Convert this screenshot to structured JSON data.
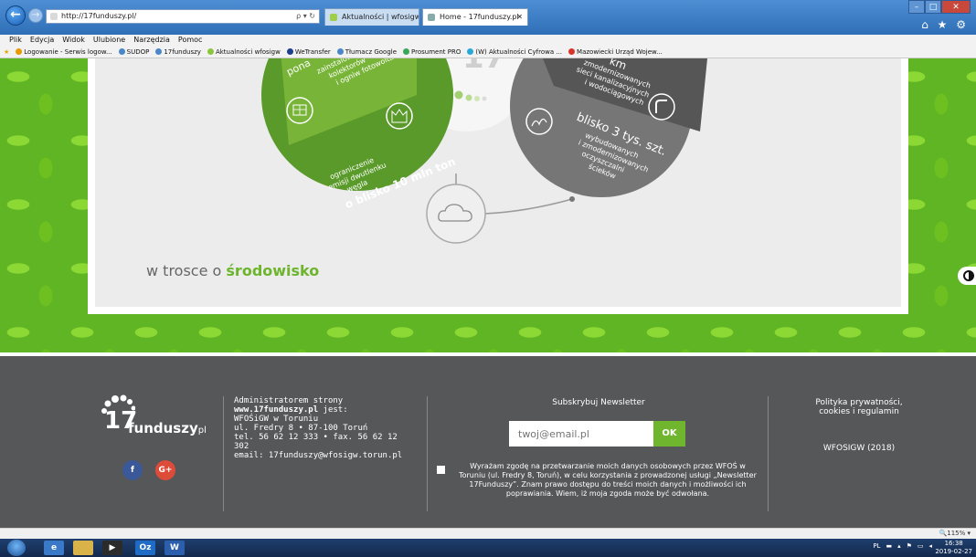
{
  "browser": {
    "address": "http://17funduszy.pl/",
    "address_actions": "ρ ▾ ↻",
    "tabs": [
      {
        "label": "Aktualności | wfosigw.pl"
      },
      {
        "label": "Home - 17funduszy.pl"
      }
    ],
    "tab_close": "✕",
    "window_controls": {
      "minimize": "–",
      "maximize": "□",
      "close": "✕"
    },
    "right_icons": "⌂ ★ ⚙"
  },
  "menu": [
    "Plik",
    "Edycja",
    "Widok",
    "Ulubione",
    "Narzędzia",
    "Pomoc"
  ],
  "favorites": [
    {
      "label": "Logowanie - Serwis logow...",
      "color": "#e69b00"
    },
    {
      "label": "SUDOP",
      "color": "#4a86c8"
    },
    {
      "label": "17funduszy",
      "color": "#4a86c8"
    },
    {
      "label": "Aktualności wfosigw",
      "color": "#8cc63f"
    },
    {
      "label": "WeTransfer",
      "color": "#1d3f8c"
    },
    {
      "label": "Tłumacz Google",
      "color": "#4a86c8"
    },
    {
      "label": "Prosument PRO",
      "color": "#3aa65a"
    },
    {
      "label": "(W) Aktualności Cyfrowa ...",
      "color": "#2aa9d9"
    },
    {
      "label": "Mazowiecki Urząd Wojew...",
      "color": "#d9342b"
    }
  ],
  "graphic": {
    "green_circle": {
      "line1": "ograniczenie",
      "line2": "emisji dwutlenku",
      "line3": "węgla",
      "highlight": "o blisko 10 mln ton"
    },
    "green_top": {
      "lines": [
        "zainstalowanych",
        "kolektorów",
        "i ogniw fotowoltaicz"
      ],
      "partial": "pona"
    },
    "grey_circle": {
      "highlight": "blisko 3 tys. szt.",
      "lines": [
        "wybudowanych",
        "i zmodernizowanych",
        "oczyszczalni",
        "ścieków"
      ]
    },
    "grey_top": {
      "partial": "km",
      "lines": [
        "zmodernizowanych",
        "sieci kanalizacyjnych",
        "i wodociągowych"
      ]
    },
    "center_partial": "17"
  },
  "tagline": {
    "prefix": "w trosce o ",
    "highlight": "środowisko"
  },
  "accessibility": {
    "contrast_icon": "contrast-icon"
  },
  "footer": {
    "logo": {
      "number": "17",
      "word": "funduszy",
      "suffix": "pl"
    },
    "social": {
      "facebook": "f",
      "gplus": "G+"
    },
    "admin": {
      "line1": "Administratorem strony",
      "site": "www.17funduszy.pl",
      "site_suffix": " jest:",
      "line3": "WFOŚiGW w Toruniu",
      "line4": "ul. Fredry 8 • 87-100 Toruń",
      "line5": "tel. 56 62 12 333 • fax. 56 62 12 302",
      "line6": "email: 17funduszy@wfosigw.torun.pl"
    },
    "newsletter": {
      "title": "Subskrybuj Newsletter",
      "email_placeholder": "twoj@email.pl",
      "ok_label": "OK",
      "consent": "Wyrażam zgodę na przetwarzanie moich danych osobowych przez WFOŚ w Toruniu (ul. Fredry 8, Toruń), w celu korzystania z prowadzonej usługi „Newsletter 17Funduszy”. Znam prawo dostępu do treści moich danych i możliwości ich poprawiania. Wiem, iż moja zgoda może być odwołana."
    },
    "privacy": {
      "line1": "Polityka prywatności,",
      "line2": "cookies i regulamin"
    },
    "copyright": "WFOSIGW (2018)"
  },
  "status": {
    "zoom": "115%"
  },
  "taskbar": {
    "apps": [
      "ie",
      "explorer",
      "media",
      "outlook",
      "word"
    ],
    "outlook_label": "Oz",
    "word_label": "W",
    "tray": "PL",
    "time": "16:38",
    "date": "2019-02-27"
  }
}
